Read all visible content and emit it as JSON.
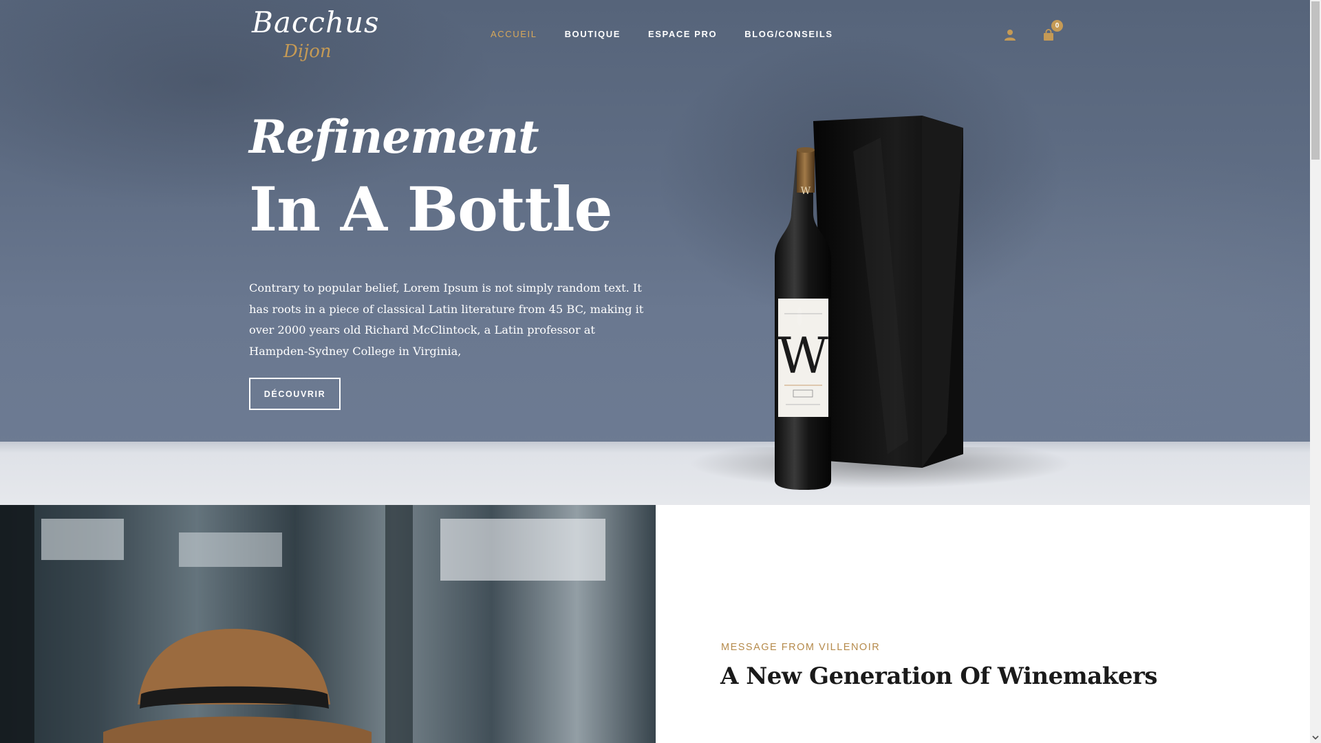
{
  "header": {
    "logo_main": "Bacchus",
    "logo_sub": "Dijon",
    "nav": [
      {
        "label": "ACCUEIL",
        "active": true
      },
      {
        "label": "BOUTIQUE",
        "active": false
      },
      {
        "label": "ESPACE PRO",
        "active": false
      },
      {
        "label": "BLOG/CONSEILS",
        "active": false
      }
    ],
    "user_icon": "user-icon",
    "cart_icon": "shopping-bag-icon",
    "cart_count": "0"
  },
  "hero": {
    "title_line1": "Refinement",
    "title_line2": "In A Bottle",
    "body": "Contrary to popular belief, Lorem Ipsum is not simply random text. It has roots in a piece of classical Latin literature from 45 BC, making it over 2000 years old Richard McClintock, a Latin professor at Hampden-Sydney College in Virginia,",
    "button_label": "DÉCOUVRIR",
    "bottle_label_letter": "W",
    "accent_color": "#c59a55"
  },
  "about": {
    "kicker": "MESSAGE FROM VILLENOIR",
    "title": "A New Generation Of Winemakers"
  }
}
